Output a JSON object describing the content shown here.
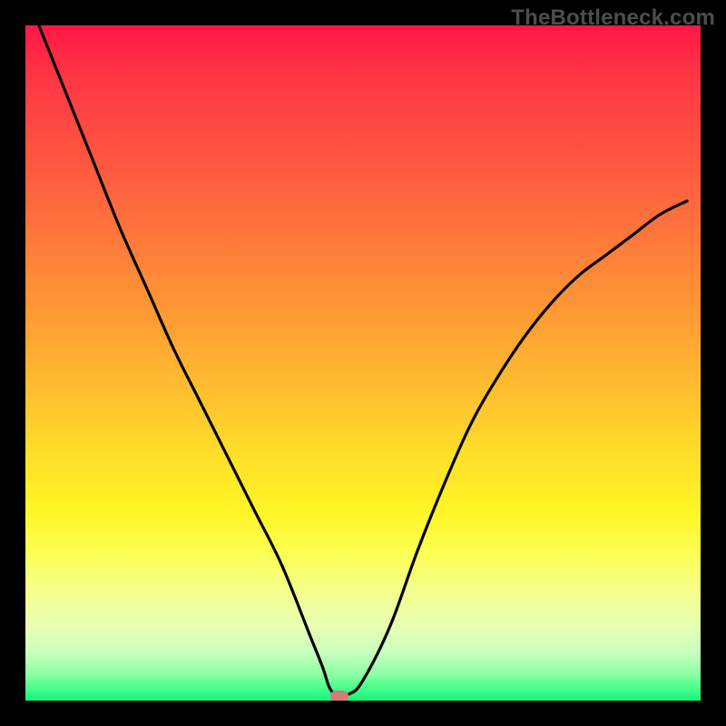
{
  "watermark": "TheBottleneck.com",
  "chart_data": {
    "type": "line",
    "title": "",
    "xlabel": "",
    "ylabel": "",
    "xlim": [
      0,
      100
    ],
    "ylim": [
      0,
      100
    ],
    "grid": false,
    "colors": {
      "curve": "#000000",
      "marker": "#d67a7a",
      "gradient_top": "#ff1846",
      "gradient_bottom": "#15f57a"
    },
    "series": [
      {
        "name": "bottleneck-curve",
        "x": [
          2,
          6,
          10,
          14,
          18,
          22,
          26,
          30,
          34,
          38,
          42,
          44,
          45,
          46,
          48,
          50,
          54,
          58,
          62,
          66,
          70,
          74,
          78,
          82,
          86,
          90,
          94,
          98
        ],
        "y": [
          100,
          90,
          80,
          70,
          61,
          52,
          44,
          36,
          28,
          20,
          10,
          5,
          2,
          1,
          1,
          3,
          11,
          22,
          32,
          41,
          48,
          54,
          59,
          63,
          66,
          69,
          72,
          74
        ]
      }
    ],
    "marker": {
      "x": 46.5,
      "y": 0.7
    },
    "gradient_stops": [
      {
        "pct": 0,
        "color": "#ff1846"
      },
      {
        "pct": 8,
        "color": "#ff3744"
      },
      {
        "pct": 20,
        "color": "#ff5640"
      },
      {
        "pct": 32,
        "color": "#ff7a3a"
      },
      {
        "pct": 44,
        "color": "#ff9e34"
      },
      {
        "pct": 55,
        "color": "#ffc22e"
      },
      {
        "pct": 64,
        "color": "#ffe028"
      },
      {
        "pct": 72,
        "color": "#fff525"
      },
      {
        "pct": 78,
        "color": "#fcff53"
      },
      {
        "pct": 84,
        "color": "#f4ff8f"
      },
      {
        "pct": 89,
        "color": "#e7ffb3"
      },
      {
        "pct": 93,
        "color": "#c7ffbe"
      },
      {
        "pct": 96,
        "color": "#8fffa5"
      },
      {
        "pct": 98,
        "color": "#4dff8e"
      },
      {
        "pct": 100,
        "color": "#15f57a"
      }
    ]
  }
}
